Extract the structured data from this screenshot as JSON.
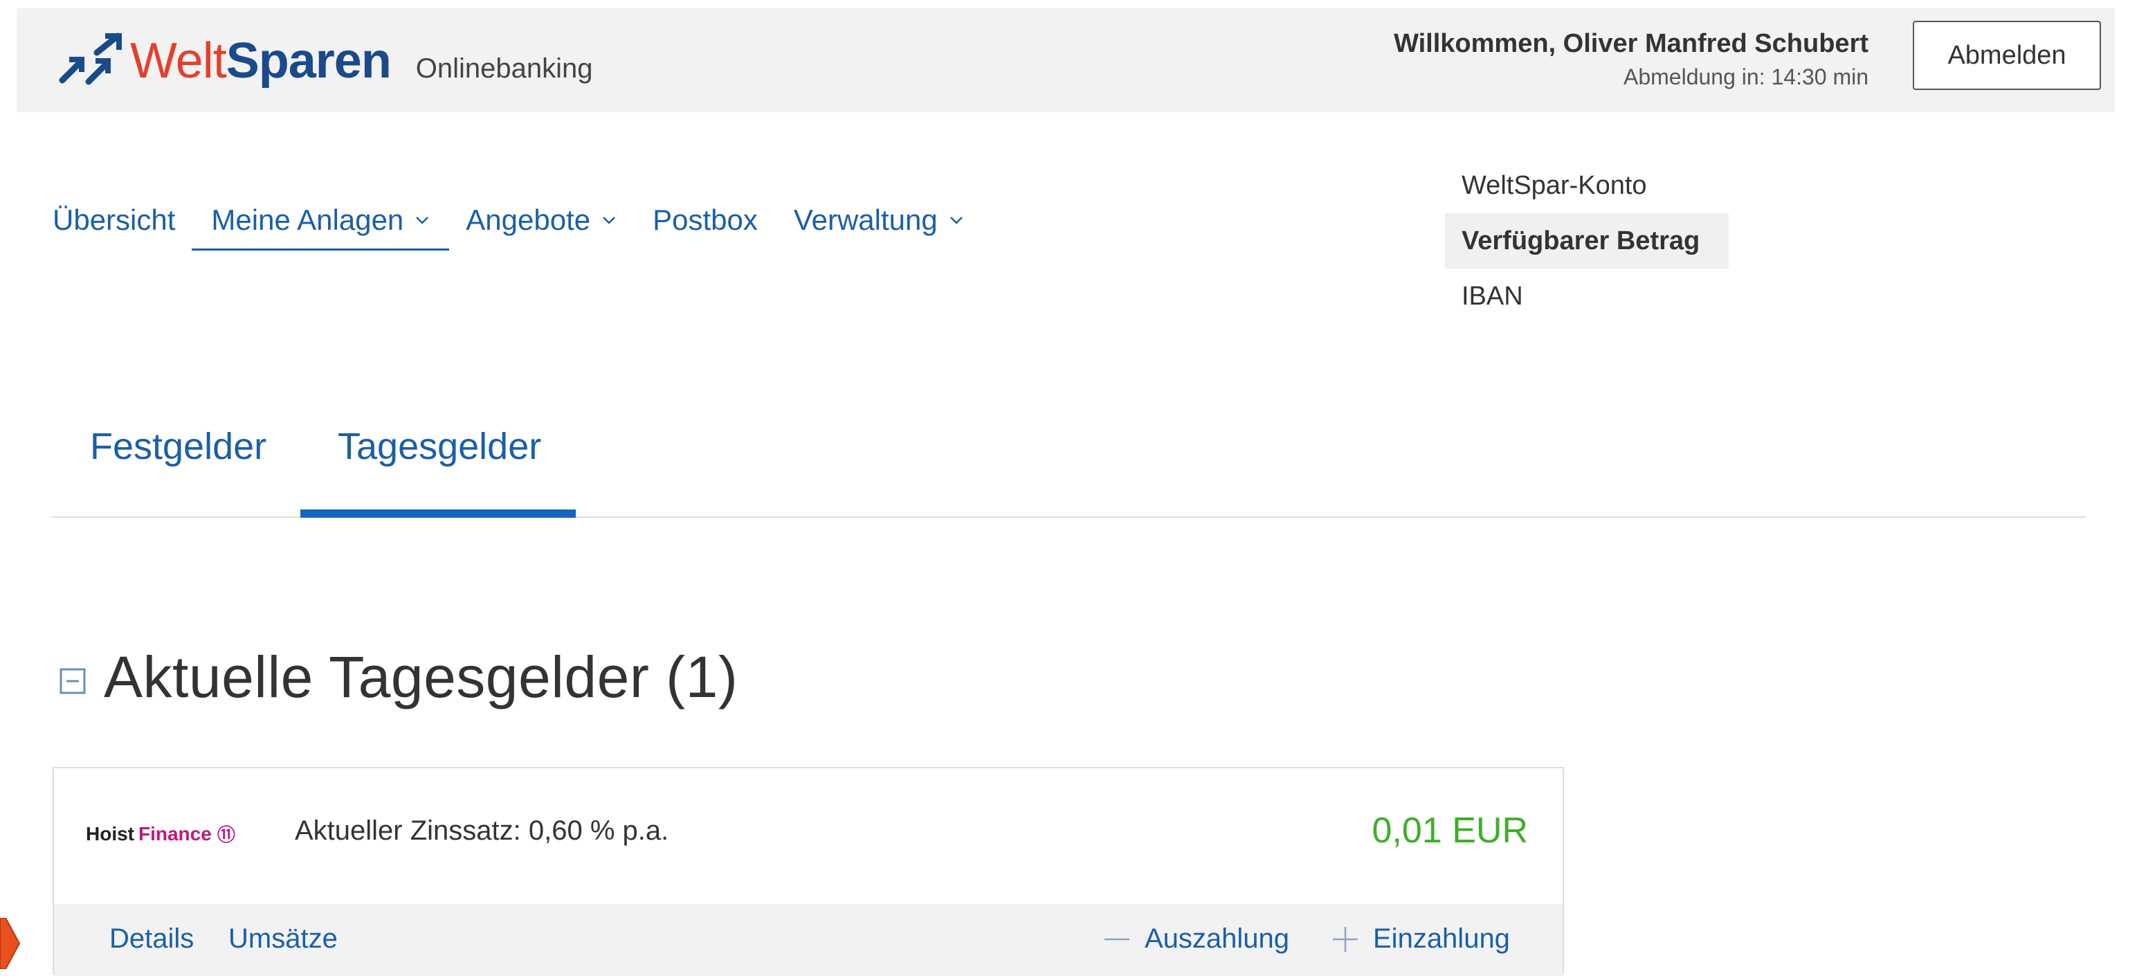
{
  "header": {
    "logo_welt": "Welt",
    "logo_sparen": "Sparen",
    "logo_sub": "Onlinebanking",
    "welcome": "Willkommen, Oliver Manfred Schubert",
    "logout_timer": "Abmeldung in: 14:30 min",
    "logout_button": "Abmelden"
  },
  "nav": {
    "items": [
      {
        "label": "Übersicht"
      },
      {
        "label": "Meine Anlagen"
      },
      {
        "label": "Angebote"
      },
      {
        "label": "Postbox"
      },
      {
        "label": "Verwaltung"
      }
    ]
  },
  "account_panel": {
    "items": [
      "WeltSpar-Konto",
      "Verfügbarer Betrag",
      "IBAN"
    ]
  },
  "tabs": [
    {
      "label": "Festgelder"
    },
    {
      "label": "Tagesgelder"
    }
  ],
  "section": {
    "title": "Aktuelle Tagesgelder (1)"
  },
  "card": {
    "bank_hoist": "Hoist",
    "bank_finance": "Finance",
    "rate": "Aktueller Zinssatz: 0,60 % p.a.",
    "amount": "0,01 EUR",
    "actions": {
      "details": "Details",
      "umsaetze": "Umsätze",
      "auszahlung": "Auszahlung",
      "einzahlung": "Einzahlung"
    }
  },
  "colors": {
    "brand_red": "#e3402c",
    "brand_blue": "#1a4a8a",
    "link_blue": "#1a5fa8",
    "amount_green": "#3fae2a",
    "finance_magenta": "#c2187a"
  }
}
